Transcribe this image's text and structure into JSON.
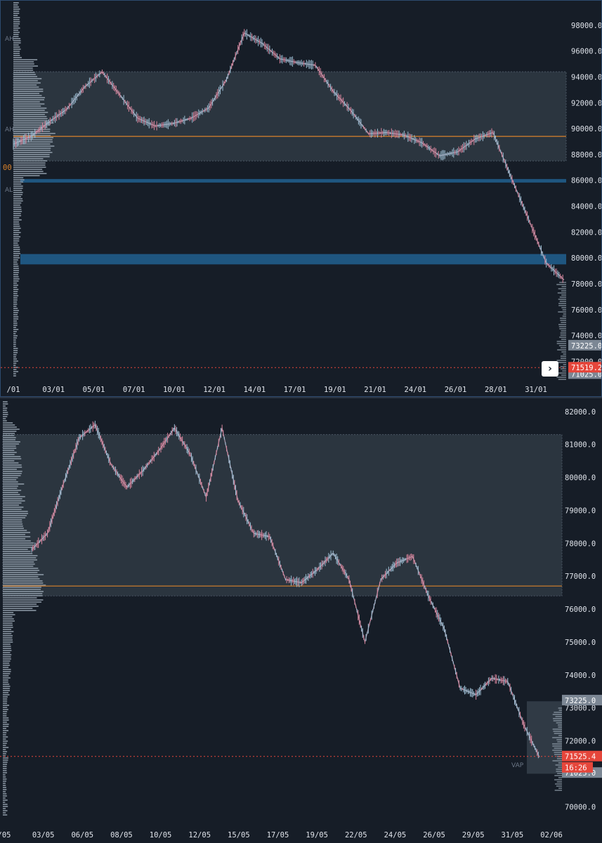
{
  "colors": {
    "background": "#161d27",
    "value_area": "#2f3944",
    "poc_line": "#d9822b",
    "zone": "#1f5680",
    "last_price": "#e5463b",
    "badge_gray": "#7c8794",
    "candle_up": "#9fc0d6",
    "candle_down": "#d9849c",
    "profile": "#9aa7b4"
  },
  "scroll_button": {
    "icon": "chevron-right-icon",
    "glyph": "›"
  },
  "chart_data": [
    {
      "type": "line",
      "ylim": [
        70500,
        100000
      ],
      "x_ticks": [
        "/01",
        "03/01",
        "05/01",
        "07/01",
        "10/01",
        "12/01",
        "14/01",
        "17/01",
        "19/01",
        "21/01",
        "24/01",
        "26/01",
        "28/01",
        "31/01"
      ],
      "y_ticks": [
        "100000.0",
        "98000.0",
        "96000.0",
        "94000.0",
        "92000.0",
        "90000.0",
        "88000.0",
        "86000.0",
        "84000.0",
        "82000.0",
        "80000.0",
        "78000.0",
        "76000.0",
        "74000.0",
        "72000.0",
        "71025.0"
      ],
      "y_tick_values": [
        100000,
        98000,
        96000,
        94000,
        92000,
        90000,
        88000,
        86000,
        84000,
        82000,
        80000,
        78000,
        76000,
        74000,
        72000,
        71025
      ],
      "series": [
        {
          "x": [
            0,
            1,
            2,
            3,
            4,
            5,
            6,
            7,
            8,
            9,
            10,
            11,
            12,
            13,
            14,
            15,
            16,
            17,
            18,
            19,
            20,
            21,
            22,
            23,
            24,
            25,
            26,
            27,
            28,
            29,
            30,
            31
          ],
          "values": [
            88800,
            89400,
            90500,
            91500,
            93200,
            94400,
            92600,
            90800,
            90200,
            90400,
            90800,
            91600,
            93800,
            97400,
            96600,
            95400,
            95100,
            94900,
            92900,
            91400,
            89600,
            89700,
            89500,
            88900,
            87900,
            88200,
            89200,
            89700,
            86300,
            83000,
            79600,
            78300
          ]
        }
      ],
      "value_area": [
        87500,
        94400
      ],
      "poc": 89400,
      "zones": [
        [
          85850,
          86100
        ],
        [
          79500,
          80300
        ]
      ],
      "last_price": {
        "value": 71519.2,
        "label": "71519.2"
      },
      "badges": [
        {
          "label": "73225.0",
          "value": 73225
        },
        {
          "label": "71025.0",
          "value": 71025
        }
      ],
      "side_labels": [
        "AH",
        "AH",
        "AL"
      ],
      "side_level_label": "00"
    },
    {
      "type": "line",
      "ylim": [
        69600,
        82400
      ],
      "x_ticks": [
        "/05",
        "03/05",
        "06/05",
        "08/05",
        "10/05",
        "12/05",
        "15/05",
        "17/05",
        "19/05",
        "22/05",
        "24/05",
        "26/05",
        "29/05",
        "31/05",
        "02/06"
      ],
      "y_ticks": [
        "82000.0",
        "81000.0",
        "80000.0",
        "79000.0",
        "78000.0",
        "77000.0",
        "76000.0",
        "75000.0",
        "74000.0",
        "73000.0",
        "72000.0",
        "71000.0",
        "70000.0"
      ],
      "y_tick_values": [
        82000,
        81000,
        80000,
        79000,
        78000,
        77000,
        76000,
        75000,
        74000,
        73000,
        72000,
        71000,
        70000
      ],
      "series": [
        {
          "x": [
            0,
            1,
            2,
            3,
            4,
            5,
            6,
            7,
            8,
            9,
            10,
            11,
            12,
            13,
            14,
            15,
            16,
            17,
            18,
            19,
            20,
            21,
            22,
            23,
            24,
            25,
            26,
            27,
            28,
            29,
            30,
            31,
            32
          ],
          "values": [
            77800,
            78300,
            79800,
            81200,
            81600,
            80400,
            79700,
            80200,
            80800,
            81500,
            80700,
            79400,
            81500,
            79300,
            78300,
            78200,
            76900,
            76800,
            77200,
            77700,
            76900,
            75000,
            76900,
            77400,
            77600,
            76400,
            75400,
            73600,
            73400,
            73900,
            73800,
            72500,
            71500
          ]
        }
      ],
      "value_area": [
        76400,
        81300
      ],
      "poc": 76700,
      "zones": [],
      "recent_box": [
        71000,
        73200
      ],
      "last_price": {
        "value": 71525.4,
        "label": "71525.4",
        "timer": "16:26"
      },
      "badges": [
        {
          "label": "73225.0",
          "value": 73225
        },
        {
          "label": "71025.0",
          "value": 71025
        }
      ],
      "side_labels": [
        "VAP"
      ]
    }
  ]
}
